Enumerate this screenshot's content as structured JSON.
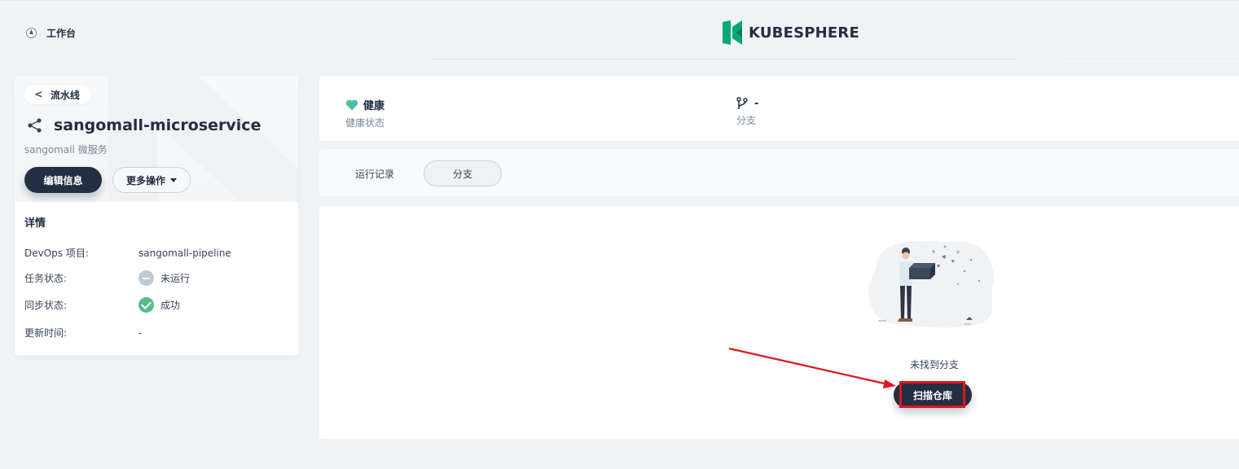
{
  "topbar": {
    "workbench_label": "工作台",
    "logo_text": "KUBESPHERE",
    "brand_color": "#00a971"
  },
  "sidebar": {
    "back_label": "流水线",
    "pipeline_name": "sangomall-microservice",
    "pipeline_desc": "sangomall 微服务",
    "edit_button": "编辑信息",
    "more_button": "更多操作",
    "details_title": "详情",
    "details": [
      {
        "key": "DevOps 项目:",
        "value": "sangomall-pipeline"
      },
      {
        "key": "任务状态:",
        "value": "未运行",
        "status": "idle"
      },
      {
        "key": "同步状态:",
        "value": "成功",
        "status": "success"
      },
      {
        "key": "更新时间:",
        "value": "-"
      }
    ]
  },
  "info": {
    "health_value": "健康",
    "health_label": "健康状态",
    "branch_value": "-",
    "branch_label": "分支"
  },
  "tabs": [
    {
      "label": "运行记录",
      "active": false
    },
    {
      "label": "分支",
      "active": true
    }
  ],
  "empty_state": {
    "message": "未找到分支",
    "scan_button": "扫描仓库"
  },
  "annotation": {
    "color": "#e0151d"
  }
}
